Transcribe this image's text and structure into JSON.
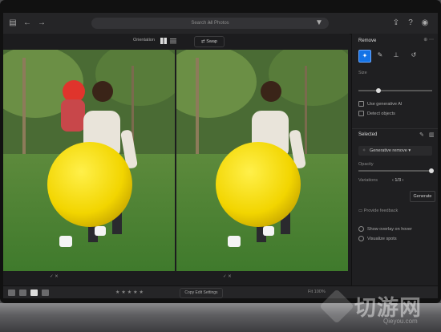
{
  "topbar": {
    "search_placeholder": "Search All Photos",
    "icons": [
      "sidebar-icon",
      "back-arrow-icon",
      "forward-arrow-icon",
      "filter-icon",
      "share-icon",
      "help-icon",
      "account-icon"
    ]
  },
  "compare": {
    "label": "Orientation",
    "swap_label": "Swap"
  },
  "filmstrip": {
    "left_controls": "✓ ✕",
    "right_controls": "✓ ✕",
    "copy_edit_label": "Copy Edit Settings",
    "fit_label": "Fit  100%"
  },
  "panel": {
    "title": "Remove",
    "size_label": "Size",
    "check_1": "Use generative AI",
    "check_2": "Detect objects",
    "selected_title": "Selected",
    "gen_label": "Generative remove",
    "opacity_label": "Opacity",
    "variations_label": "Variations",
    "variation_value": "1/3",
    "generate_label": "Generate",
    "feedback_label": "Provide feedback",
    "option_1": "Show overlay on hover",
    "option_2": "Visualize spots"
  },
  "watermark": {
    "text": "切游网",
    "sub": "Qieyou.com"
  }
}
